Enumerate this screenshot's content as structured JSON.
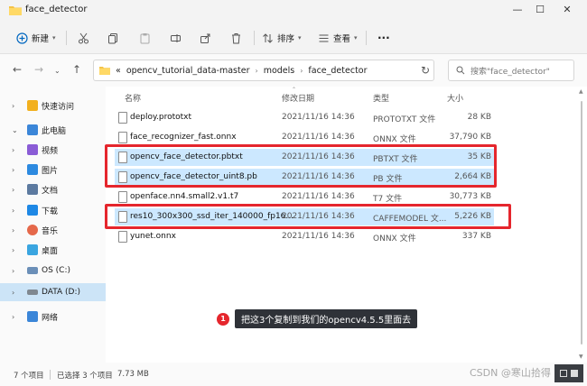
{
  "window": {
    "title": "face_detector",
    "controls": [
      "minimize-icon",
      "maximize-icon",
      "close-icon"
    ]
  },
  "toolbar": {
    "new_label": "新建",
    "sort_label": "排序",
    "view_label": "查看",
    "more_label": "···"
  },
  "nav": {
    "address_prefix": "«",
    "path": [
      "opencv_tutorial_data-master",
      "models",
      "face_detector"
    ],
    "search_placeholder": "搜索\"face_detector\""
  },
  "sidebar": {
    "items": [
      {
        "label": "快速访问",
        "icon": "star-icon",
        "color": "#f2b01e"
      },
      {
        "label": "此电脑",
        "icon": "computer-icon",
        "color": "#3b86d8"
      },
      {
        "label": "视频",
        "icon": "video-icon",
        "color": "#8a5cd6"
      },
      {
        "label": "图片",
        "icon": "picture-icon",
        "color": "#2d8ae0"
      },
      {
        "label": "文档",
        "icon": "document-icon",
        "color": "#5c7aa0"
      },
      {
        "label": "下载",
        "icon": "download-icon",
        "color": "#1e88e5"
      },
      {
        "label": "音乐",
        "icon": "music-icon",
        "color": "#e5684a"
      },
      {
        "label": "桌面",
        "icon": "desktop-icon",
        "color": "#3aa5e0"
      },
      {
        "label": "OS (C:)",
        "icon": "drive-icon",
        "color": "#6b8fb8"
      },
      {
        "label": "DATA (D:)",
        "icon": "drive-icon",
        "color": "#808890"
      },
      {
        "label": "网络",
        "icon": "network-icon",
        "color": "#3b86d8"
      }
    ]
  },
  "columns": {
    "name": "名称",
    "date": "修改日期",
    "type": "类型",
    "size": "大小"
  },
  "files": [
    {
      "name": "deploy.prototxt",
      "date": "2021/11/16 14:36",
      "type": "PROTOTXT 文件",
      "size": "28 KB"
    },
    {
      "name": "face_recognizer_fast.onnx",
      "date": "2021/11/16 14:36",
      "type": "ONNX 文件",
      "size": "37,790 KB"
    },
    {
      "name": "opencv_face_detector.pbtxt",
      "date": "2021/11/16 14:36",
      "type": "PBTXT 文件",
      "size": "35 KB"
    },
    {
      "name": "opencv_face_detector_uint8.pb",
      "date": "2021/11/16 14:36",
      "type": "PB 文件",
      "size": "2,664 KB"
    },
    {
      "name": "openface.nn4.small2.v1.t7",
      "date": "2021/11/16 14:36",
      "type": "T7 文件",
      "size": "30,773 KB"
    },
    {
      "name": "res10_300x300_ssd_iter_140000_fp16...",
      "date": "2021/11/16 14:36",
      "type": "CAFFEMODEL 文...",
      "size": "5,226 KB"
    },
    {
      "name": "yunet.onnx",
      "date": "2021/11/16 14:36",
      "type": "ONNX 文件",
      "size": "337 KB"
    }
  ],
  "annotation": {
    "number": "1",
    "text": "把这3个复制到我们的opencv4.5.5里面去"
  },
  "status": {
    "count": "7 个项目",
    "selected": "已选择 3 个项目",
    "size": "7.73 MB"
  },
  "watermark": "CSDN @寒山拾得",
  "colors": {
    "highlight": "#e5262d",
    "selection": "#cce8ff",
    "accent": "#0067c0"
  }
}
